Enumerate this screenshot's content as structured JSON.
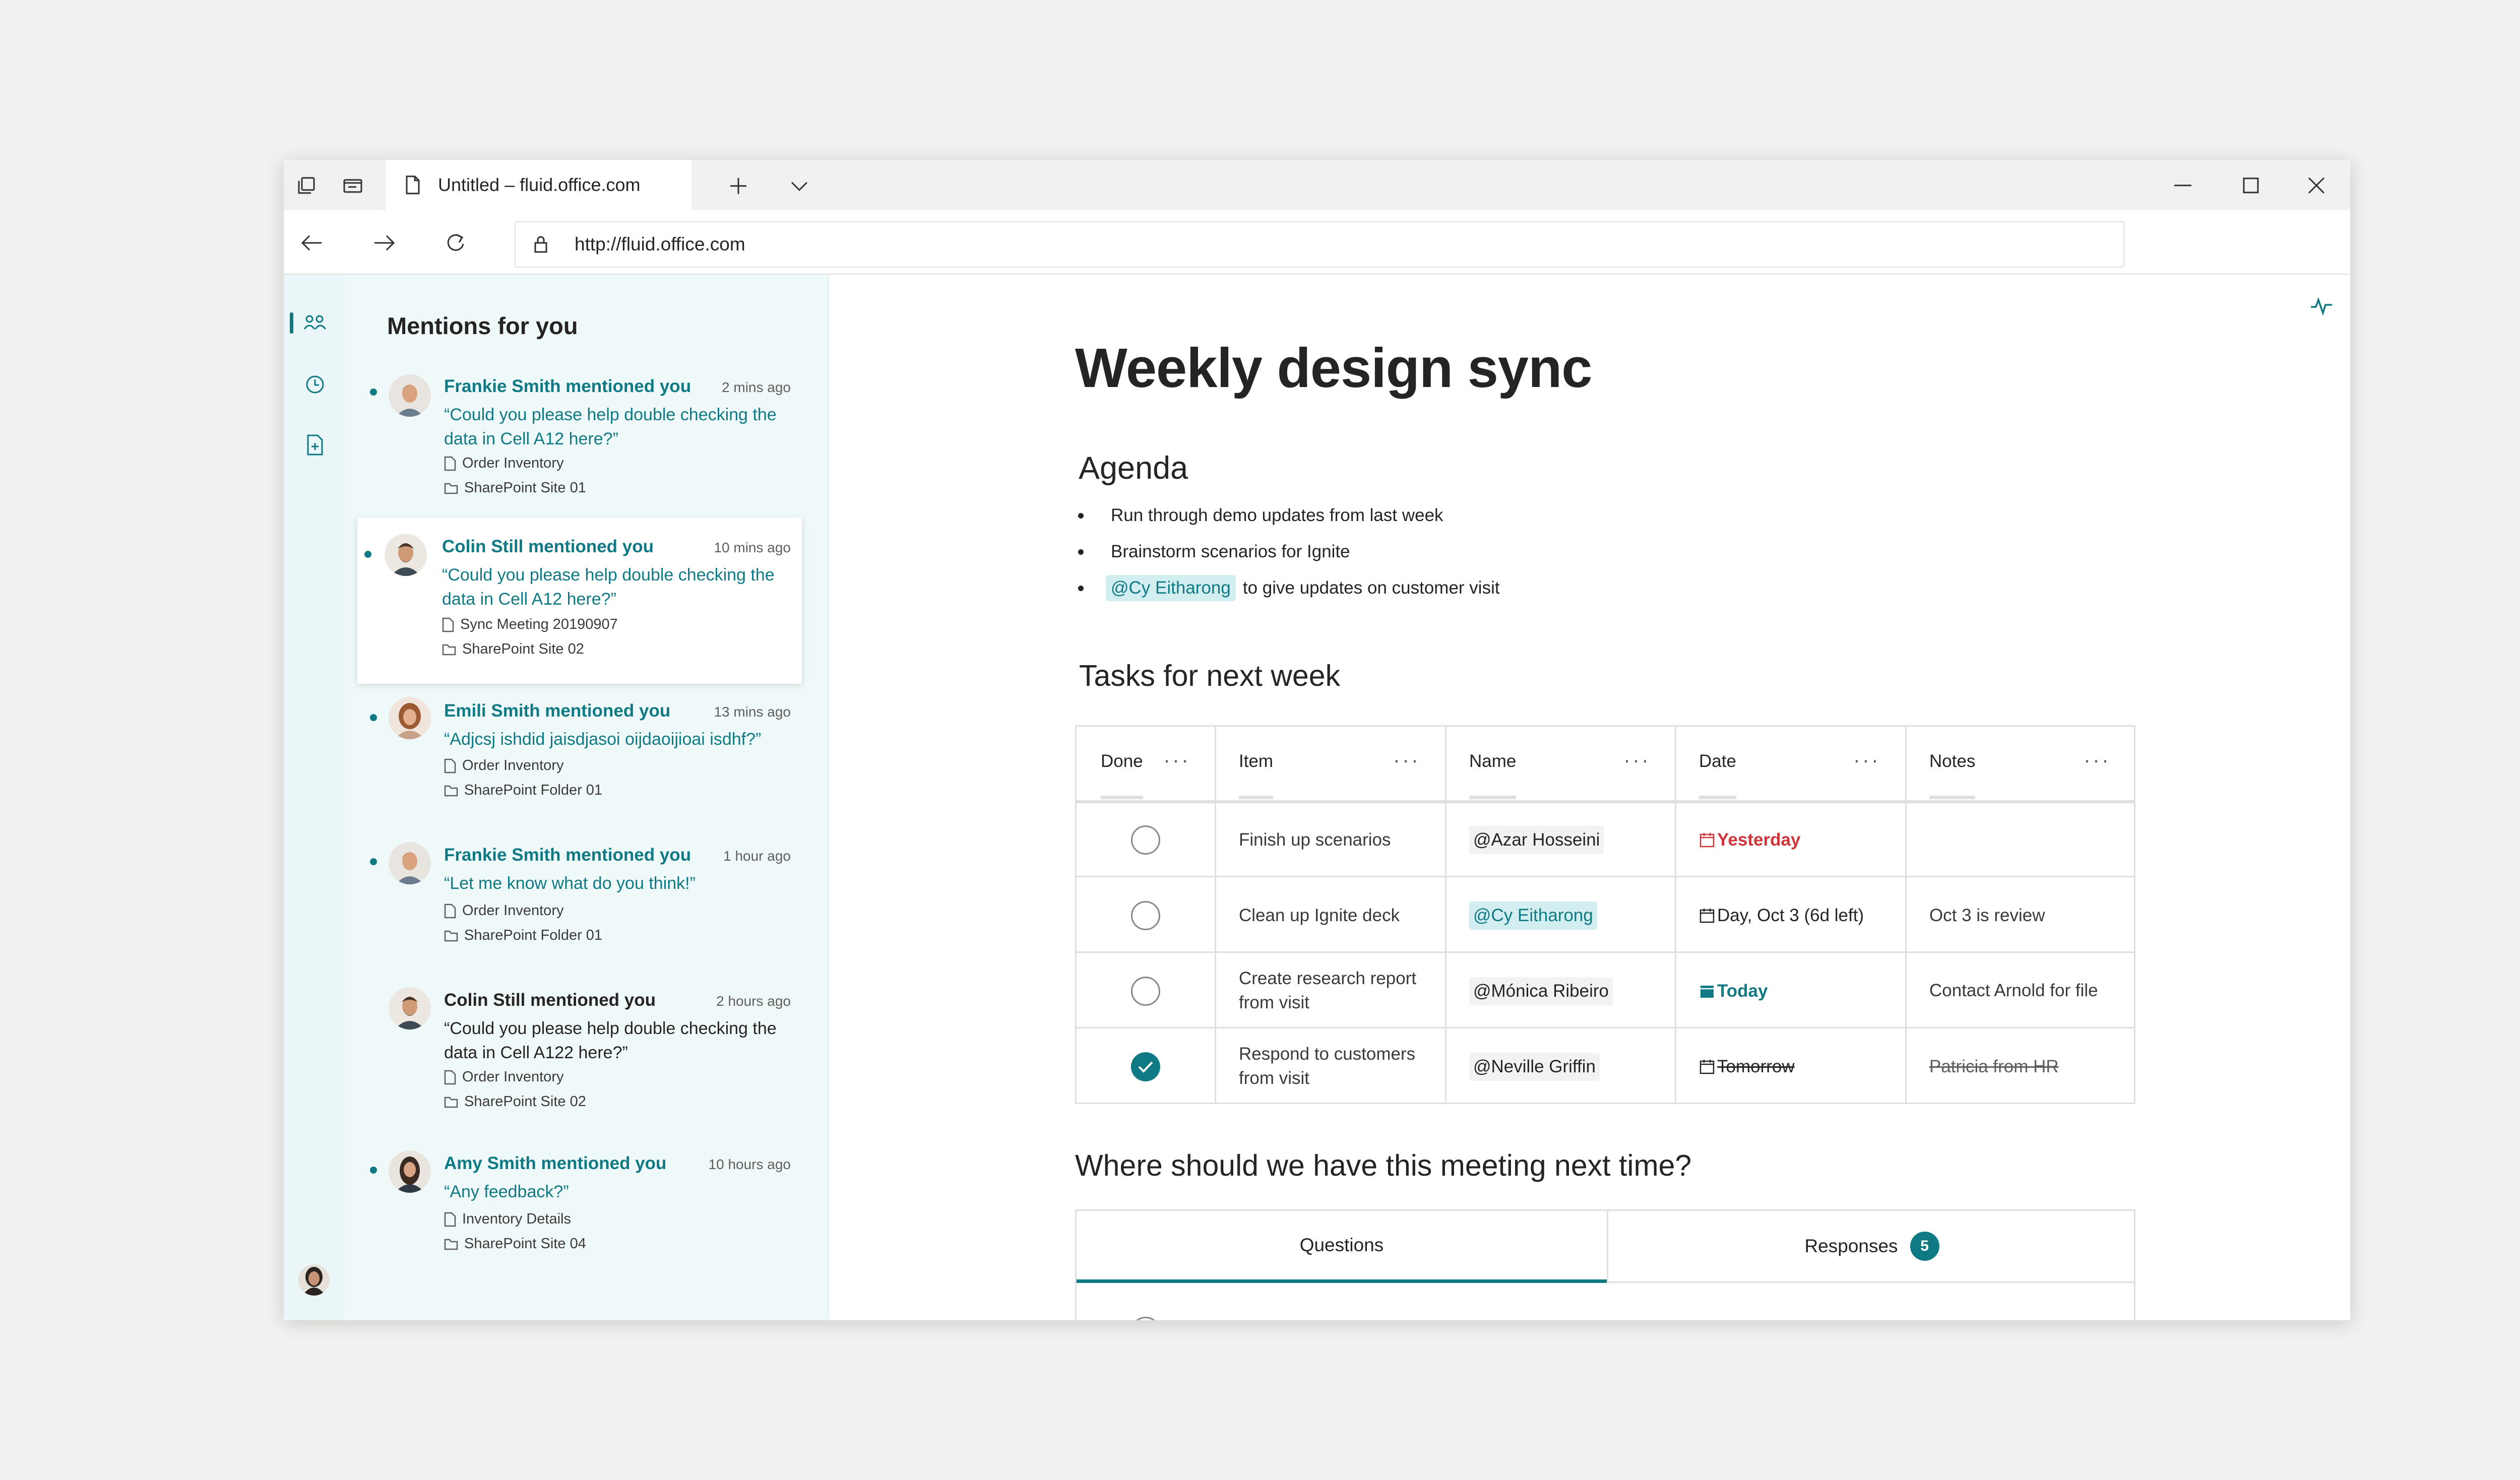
{
  "browser": {
    "tab_title": "Untitled – fluid.office.com",
    "url": "http://fluid.office.com"
  },
  "mentions": {
    "title": "Mentions for you",
    "items": [
      {
        "who": "Frankie Smith mentioned you",
        "time": "2 mins ago",
        "quote": "“Could you please help double checking the data in Cell A12 here?”",
        "file": "Order Inventory",
        "folder": "SharePoint Site 01",
        "unread": true
      },
      {
        "who": "Colin Still mentioned you",
        "time": "10 mins ago",
        "quote": "“Could you please help double checking the data in Cell A12 here?”",
        "file": "Sync Meeting 20190907",
        "folder": "SharePoint Site 02",
        "unread": true
      },
      {
        "who": "Emili Smith mentioned you",
        "time": "13 mins ago",
        "quote": "“Adjcsj ishdid jaisdjasoi oijdaoijioai isdhf?”",
        "file": "Order Inventory",
        "folder": "SharePoint Folder 01",
        "unread": true
      },
      {
        "who": "Frankie Smith mentioned you",
        "time": "1 hour ago",
        "quote": "“Let me know what do you think!”",
        "file": "Order Inventory",
        "folder": "SharePoint Folder 01",
        "unread": true
      },
      {
        "who": "Colin Still mentioned you",
        "time": "2 hours ago",
        "quote": "“Could you please help double checking the data in Cell A122 here?”",
        "file": "Order Inventory",
        "folder": "SharePoint Site 02",
        "unread": false
      },
      {
        "who": "Amy Smith mentioned you",
        "time": "10 hours ago",
        "quote": "“Any feedback?”",
        "file": "Inventory Details",
        "folder": "SharePoint Site 04",
        "unread": true
      }
    ]
  },
  "document": {
    "title": "Weekly design sync",
    "agenda_heading": "Agenda",
    "agenda": [
      "Run through demo updates from last week",
      "Brainstorm scenarios for Ignite"
    ],
    "agenda_mention": "@Cy Eitharong",
    "agenda_mention_rest": "to give updates on customer visit",
    "tasks_heading": "Tasks for next week",
    "columns": [
      "Done",
      "Item",
      "Name",
      "Date",
      "Notes"
    ],
    "rows": [
      {
        "done": false,
        "item": "Finish up scenarios",
        "name": "@Azar Hosseini",
        "date": "Yesterday",
        "notes": ""
      },
      {
        "done": false,
        "item": "Clean up Ignite deck",
        "name": "@Cy Eitharong",
        "date": "Day, Oct 3 (6d left)",
        "notes": "Oct 3 is review"
      },
      {
        "done": false,
        "item": "Create research report from visit",
        "name": "@Mónica Ribeiro",
        "date": "Today",
        "notes": "Contact Arnold for file"
      },
      {
        "done": true,
        "item": "Respond to customers from visit",
        "name": "@Neville Griffin",
        "date": "Tomorrow",
        "notes": "Patricia from HR"
      }
    ],
    "poll_heading": "Where should we have this meeting next time?",
    "poll_tabs": {
      "questions": "Questions",
      "responses": "Responses",
      "responses_count": "5"
    }
  },
  "colors": {
    "accent": "#0f7a83",
    "overdue": "#d13438",
    "panel_bg": "#f0f9fa"
  },
  "icons": [
    "tab-collections-icon",
    "tab-aside-icon",
    "page-icon",
    "new-tab-icon",
    "chevron-down-icon",
    "minimize-icon",
    "maximize-icon",
    "close-icon",
    "back-icon",
    "forward-icon",
    "refresh-icon",
    "lock-icon",
    "people-icon",
    "clock-icon",
    "file-add-icon",
    "activity-icon",
    "file-icon",
    "folder-icon",
    "calendar-icon",
    "checkmark-icon"
  ]
}
